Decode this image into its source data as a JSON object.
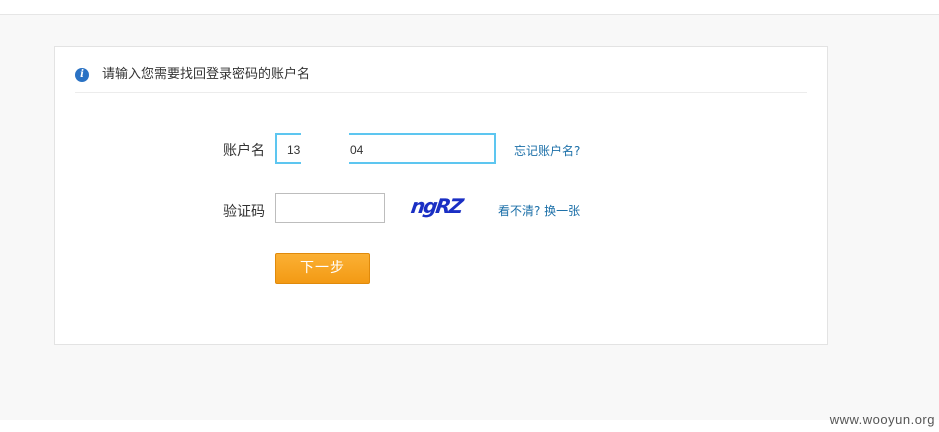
{
  "header": {
    "info_icon_glyph": "i",
    "instruction": "请输入您需要找回登录密码的账户名"
  },
  "form": {
    "account_label": "账户名",
    "account_value_prefix": "13",
    "account_value_suffix": "04",
    "forgot_account_link": "忘记账户名?",
    "captcha_label": "验证码",
    "captcha_value": "",
    "captcha_text": "ngRZ",
    "refresh_captcha_link": "看不清? 换一张",
    "next_button": "下一步"
  },
  "watermark": "www.wooyun.org",
  "colors": {
    "accent_link": "#1b6fa8",
    "focus_border": "#5dc6f0",
    "button_orange": "#f5a020",
    "info_icon": "#2a72c4",
    "captcha_blue": "#1a2fc4"
  },
  "icons": {
    "header_icon": "info-icon"
  }
}
